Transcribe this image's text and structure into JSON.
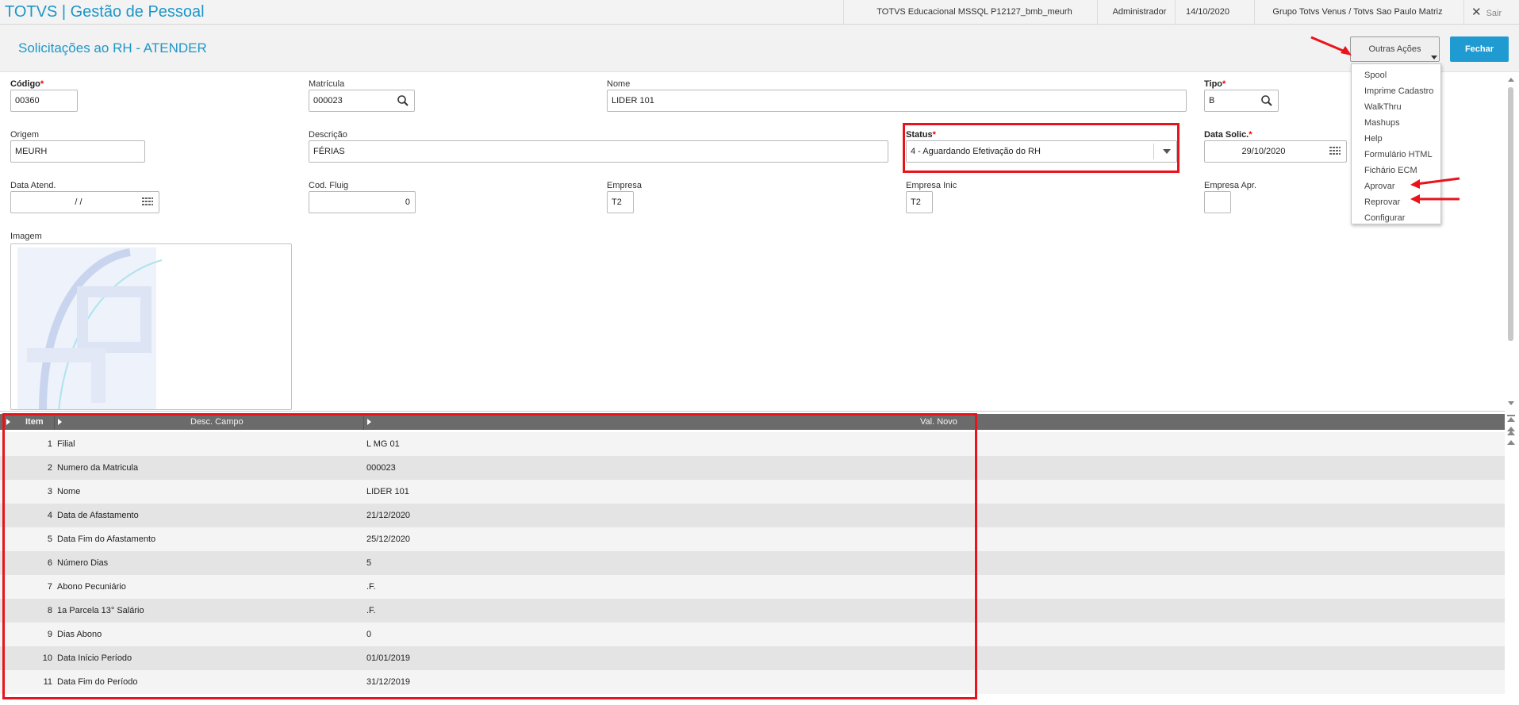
{
  "topbar": {
    "app_title": "TOTVS | Gestão de Pessoal",
    "environment": "TOTVS Educacional MSSQL P12127_bmb_meurh",
    "user": "Administrador",
    "date": "14/10/2020",
    "company": "Grupo Totvs Venus / Totvs Sao Paulo Matriz",
    "exit_label": "Sair"
  },
  "header": {
    "page_title": "Solicitações ao RH - ATENDER",
    "actions_label": "Outras Ações",
    "close_label": "Fechar"
  },
  "menu": {
    "items": [
      "Spool",
      "Imprime Cadastro",
      "WalkThru",
      "Mashups",
      "Help",
      "Formulário HTML",
      "Fichário ECM",
      "Aprovar",
      "Reprovar",
      "Configurar"
    ]
  },
  "form": {
    "codigo": {
      "label": "Código",
      "value": "00360"
    },
    "matricula": {
      "label": "Matrícula",
      "value": "000023"
    },
    "nome": {
      "label": "Nome",
      "value": "LIDER 101"
    },
    "tipo": {
      "label": "Tipo",
      "value": "B"
    },
    "origem": {
      "label": "Origem",
      "value": "MEURH"
    },
    "descricao": {
      "label": "Descrição",
      "value": "FÉRIAS"
    },
    "status": {
      "label": "Status",
      "value": "4 - Aguardando Efetivação do RH"
    },
    "data_solic": {
      "label": "Data Solic.",
      "value": "29/10/2020"
    },
    "data_atend": {
      "label": "Data Atend.",
      "value": "/ /"
    },
    "cod_fluig": {
      "label": "Cod. Fluig",
      "value": "0"
    },
    "empresa": {
      "label": "Empresa",
      "value": "T2"
    },
    "empresa_inic": {
      "label": "Empresa Inic",
      "value": "T2"
    },
    "empresa_apr": {
      "label": "Empresa Apr.",
      "value": ""
    },
    "imagem": {
      "label": "Imagem"
    }
  },
  "grid": {
    "headers": [
      "Item",
      "Desc. Campo",
      "Val. Novo"
    ],
    "rows": [
      [
        "1",
        "Filial",
        "L MG 01"
      ],
      [
        "2",
        "Numero da Matricula",
        "000023"
      ],
      [
        "3",
        "Nome",
        "LIDER 101"
      ],
      [
        "4",
        "Data de Afastamento",
        "21/12/2020"
      ],
      [
        "5",
        "Data Fim do Afastamento",
        "25/12/2020"
      ],
      [
        "6",
        "Número Dias",
        "5"
      ],
      [
        "7",
        "Abono Pecuniário",
        ".F."
      ],
      [
        "8",
        "1a Parcela 13° Salário",
        ".F."
      ],
      [
        "9",
        "Dias Abono",
        "0"
      ],
      [
        "10",
        "Data Início Período",
        "01/01/2019"
      ],
      [
        "11",
        "Data Fim do Período",
        "31/12/2019"
      ]
    ]
  },
  "colors": {
    "accent": "#1e96c8",
    "primary_button": "#1f9bd1",
    "highlight": "#e8141b",
    "grid_header": "#6b6b6b"
  }
}
